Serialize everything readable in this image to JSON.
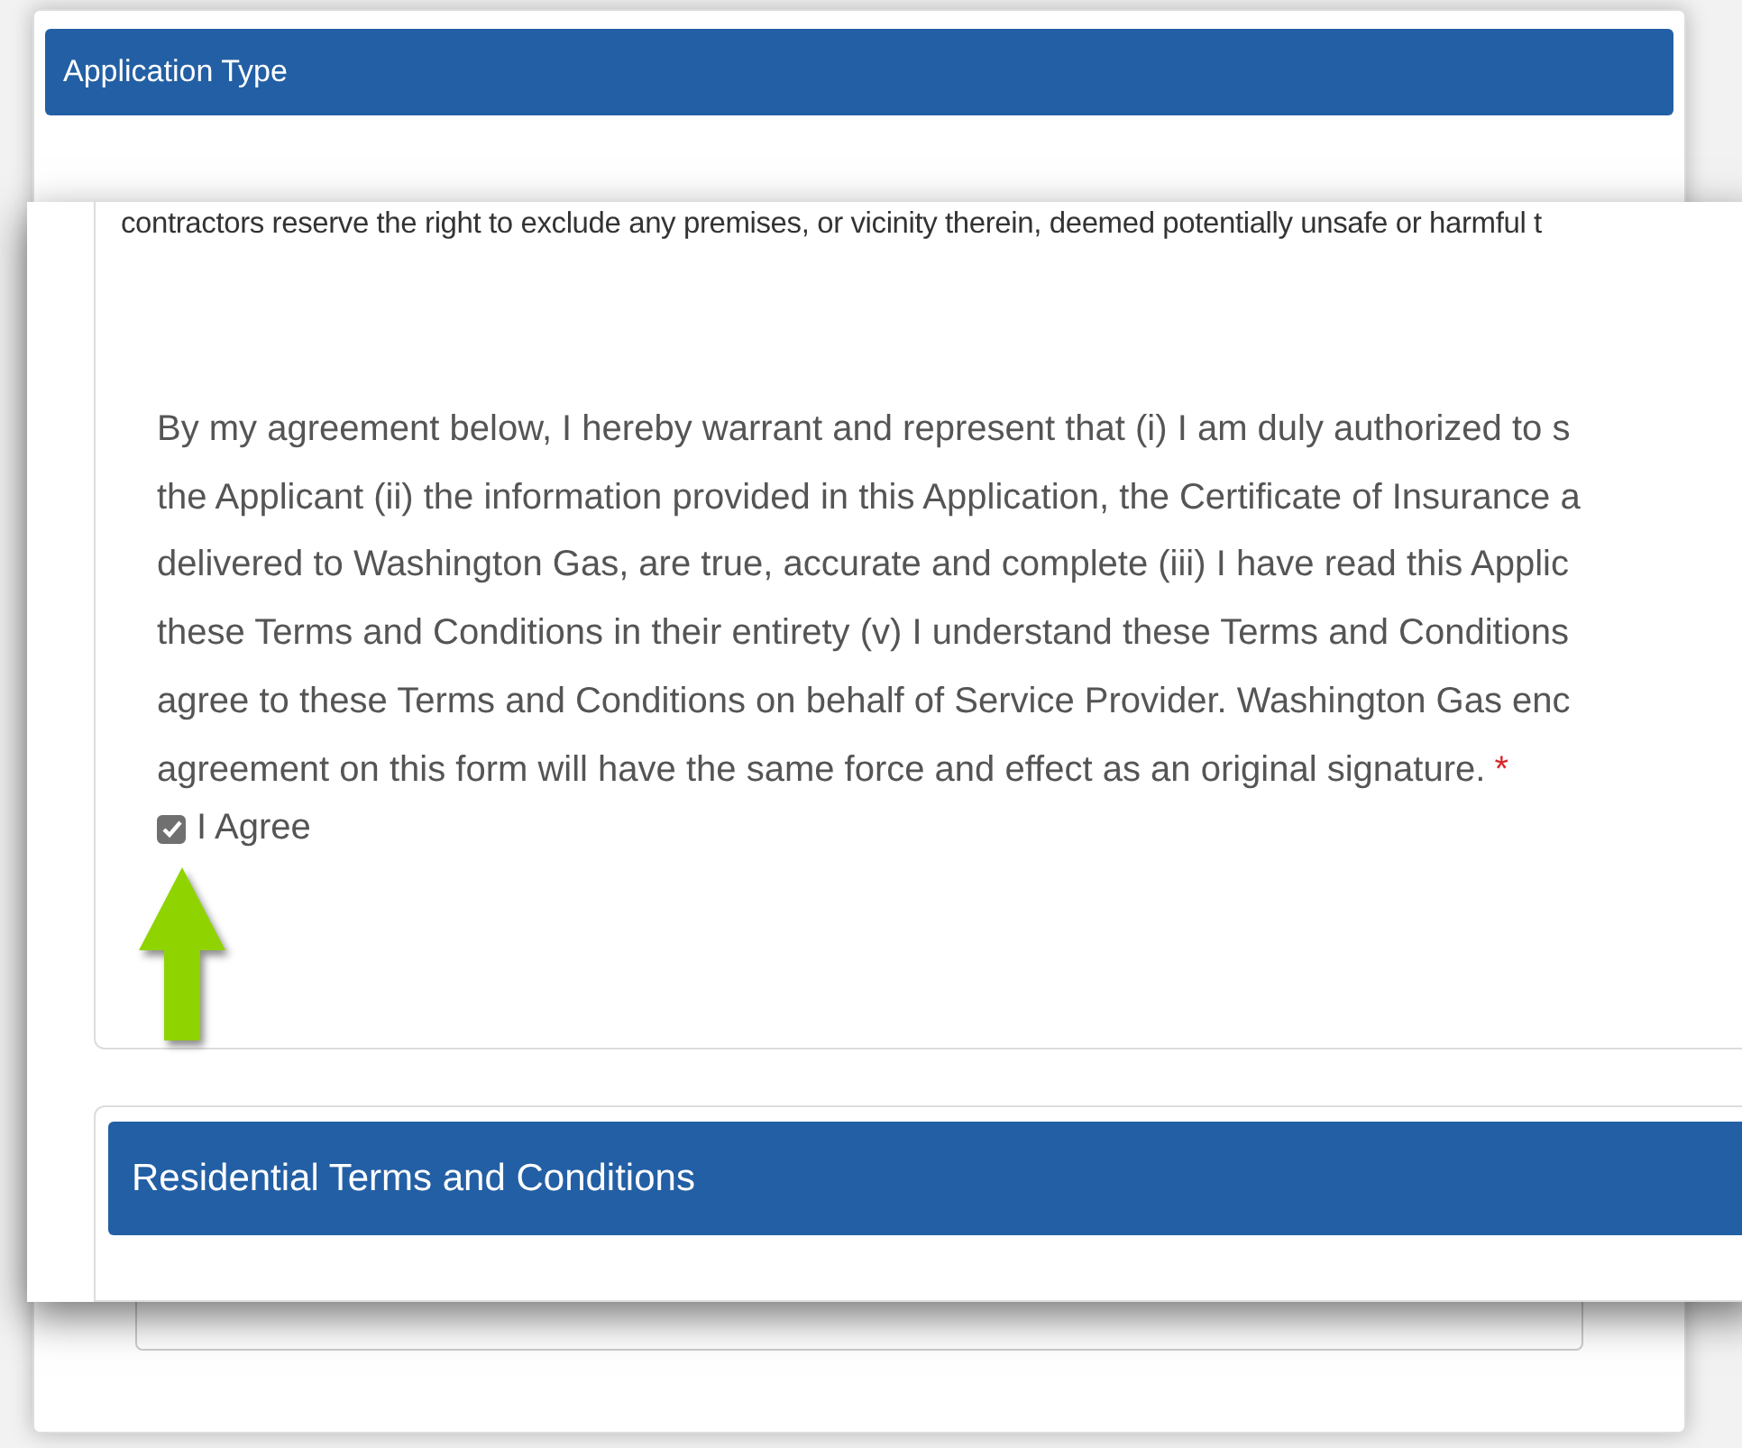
{
  "back_panel": {
    "header": "Application Type"
  },
  "front_panel": {
    "cut_text": "contractors reserve the right to exclude any premises, or vicinity therein, deemed potentially unsafe or harmful t",
    "agreement_lines": [
      "By my agreement below, I hereby warrant and represent that (i) I am duly authorized to s",
      "the Applicant (ii) the information provided in this Application, the Certificate of Insurance a",
      "delivered to Washington Gas, are true, accurate and complete (iii) I have read this Applic",
      "these Terms and Conditions in their entirety (v) I understand these Terms and Conditions",
      "agree to these Terms and Conditions on behalf of Service Provider. Washington Gas enc",
      "agreement on this form will have the same force and effect as an original signature."
    ],
    "required_mark": "*",
    "agree": {
      "label": "I Agree",
      "checked": true
    },
    "next_section": "Residential Terms and Conditions"
  }
}
